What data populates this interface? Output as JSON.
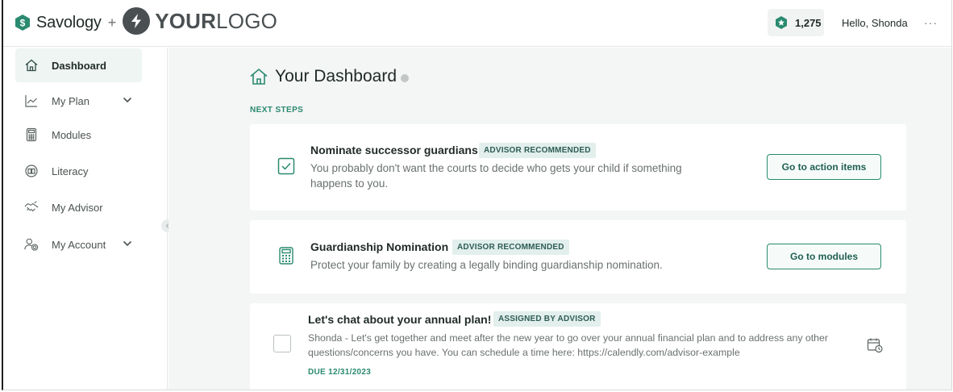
{
  "header": {
    "brand_name": "Savology",
    "brand_plus": "+",
    "partner_logo_bold": "YOUR",
    "partner_logo_light": "LOGO",
    "points": "1,275",
    "greeting": "Hello, Shonda",
    "more_icon": "···"
  },
  "sidebar": {
    "items": [
      {
        "label": "Dashboard",
        "icon": "home-icon",
        "active": true
      },
      {
        "label": "My Plan",
        "icon": "trend-chart-icon",
        "has_chevron": true
      },
      {
        "label": "Modules",
        "icon": "calculator-icon"
      },
      {
        "label": "Literacy",
        "icon": "literacy-icon"
      },
      {
        "label": "My Advisor",
        "icon": "handshake-icon"
      },
      {
        "label": "My Account",
        "icon": "user-settings-icon",
        "has_chevron": true
      }
    ]
  },
  "main": {
    "title": "Your Dashboard",
    "section_label": "NEXT STEPS",
    "cards": [
      {
        "title": "Nominate successor guardians",
        "badge": "ADVISOR RECOMMENDED",
        "description": "You probably don't want the courts to decide who gets your child if something happens to you.",
        "button": "Go to action items",
        "icon": "checked-box-icon"
      },
      {
        "title": "Guardianship Nomination",
        "badge": "ADVISOR RECOMMENDED",
        "description": "Protect your family by creating a legally binding guardianship nomination.",
        "button": "Go to modules",
        "icon": "calculator-icon"
      },
      {
        "title": "Let's chat about your annual plan!",
        "badge": "ASSIGNED BY ADVISOR",
        "description": "Shonda - Let's get together and meet after the new year to go over your annual financial plan and to address any other questions/concerns you have. You can schedule a time here: https://calendly.com/advisor-example",
        "due": "DUE 12/31/2023",
        "icon": "checkbox-empty-icon",
        "action_icon": "calendar-clock-icon"
      }
    ]
  },
  "colors": {
    "brand_green": "#2a8a6f",
    "badge_bg": "#e2efec",
    "main_bg": "#f4f5f5",
    "active_nav_bg": "#eef5f3"
  }
}
